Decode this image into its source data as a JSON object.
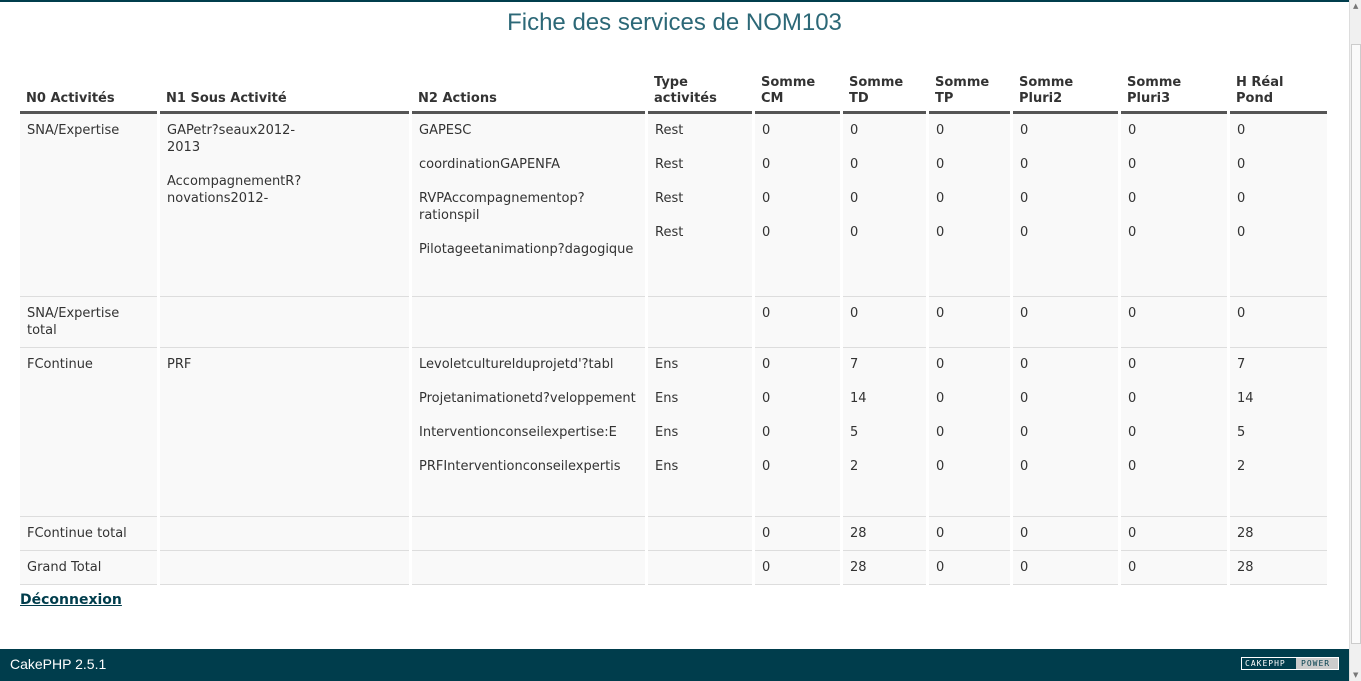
{
  "page": {
    "title": "Fiche des services de NOM103",
    "logout": "Déconnexion"
  },
  "table": {
    "headers": [
      "N0 Activités",
      "N1 Sous Activité",
      "N2 Actions",
      "Type activités",
      "Somme CM",
      "Somme TD",
      "Somme TP",
      "Somme Pluri2",
      "Somme Pluri3",
      "H Réal Pond"
    ],
    "rows": [
      {
        "type": "main",
        "cells": [
          [
            "SNA/Expertise"
          ],
          [
            "GAPetr?seaux2012-2013",
            "AccompagnementR?novations2012-"
          ],
          [
            "GAPESC",
            "coordinationGAPENFA",
            "RVPAccompagnementop?rationspil",
            "Pilotageetanimationp?dagogique"
          ],
          [
            "Rest",
            "Rest",
            "Rest",
            "Rest"
          ],
          [
            "0",
            "0",
            "0",
            "0"
          ],
          [
            "0",
            "0",
            "0",
            "0"
          ],
          [
            "0",
            "0",
            "0",
            "0"
          ],
          [
            "0",
            "0",
            "0",
            "0"
          ],
          [
            "0",
            "0",
            "0",
            "0"
          ],
          [
            "0",
            "0",
            "0",
            "0"
          ]
        ]
      },
      {
        "type": "total",
        "cells": [
          [
            "SNA/Expertise total"
          ],
          [],
          [],
          [],
          [
            "0"
          ],
          [
            "0"
          ],
          [
            "0"
          ],
          [
            "0"
          ],
          [
            "0"
          ],
          [
            "0"
          ]
        ]
      },
      {
        "type": "main",
        "cells": [
          [
            "FContinue"
          ],
          [
            "PRF"
          ],
          [
            "Levoletculturelduprojetd'?tabl",
            "Projetanimationetd?veloppement",
            "Interventionconseilexpertise:E",
            "PRFInterventionconseilexpertis"
          ],
          [
            "Ens",
            "Ens",
            "Ens",
            "Ens"
          ],
          [
            "0",
            "0",
            "0",
            "0"
          ],
          [
            "7",
            "14",
            "5",
            "2"
          ],
          [
            "0",
            "0",
            "0",
            "0"
          ],
          [
            "0",
            "0",
            "0",
            "0"
          ],
          [
            "0",
            "0",
            "0",
            "0"
          ],
          [
            "7",
            "14",
            "5",
            "2"
          ]
        ]
      },
      {
        "type": "total",
        "cells": [
          [
            "FContinue total"
          ],
          [],
          [],
          [],
          [
            "0"
          ],
          [
            "28"
          ],
          [
            "0"
          ],
          [
            "0"
          ],
          [
            "0"
          ],
          [
            "28"
          ]
        ]
      },
      {
        "type": "total",
        "cells": [
          [
            "Grand Total"
          ],
          [],
          [],
          [],
          [
            "0"
          ],
          [
            "28"
          ],
          [
            "0"
          ],
          [
            "0"
          ],
          [
            "0"
          ],
          [
            "28"
          ]
        ]
      }
    ]
  },
  "footer": {
    "version": "CakePHP 2.5.1",
    "badge_left": "CAKEPHP",
    "badge_right": "POWER"
  },
  "colors": {
    "footer": "#003d4c",
    "title": "#2c6877"
  }
}
